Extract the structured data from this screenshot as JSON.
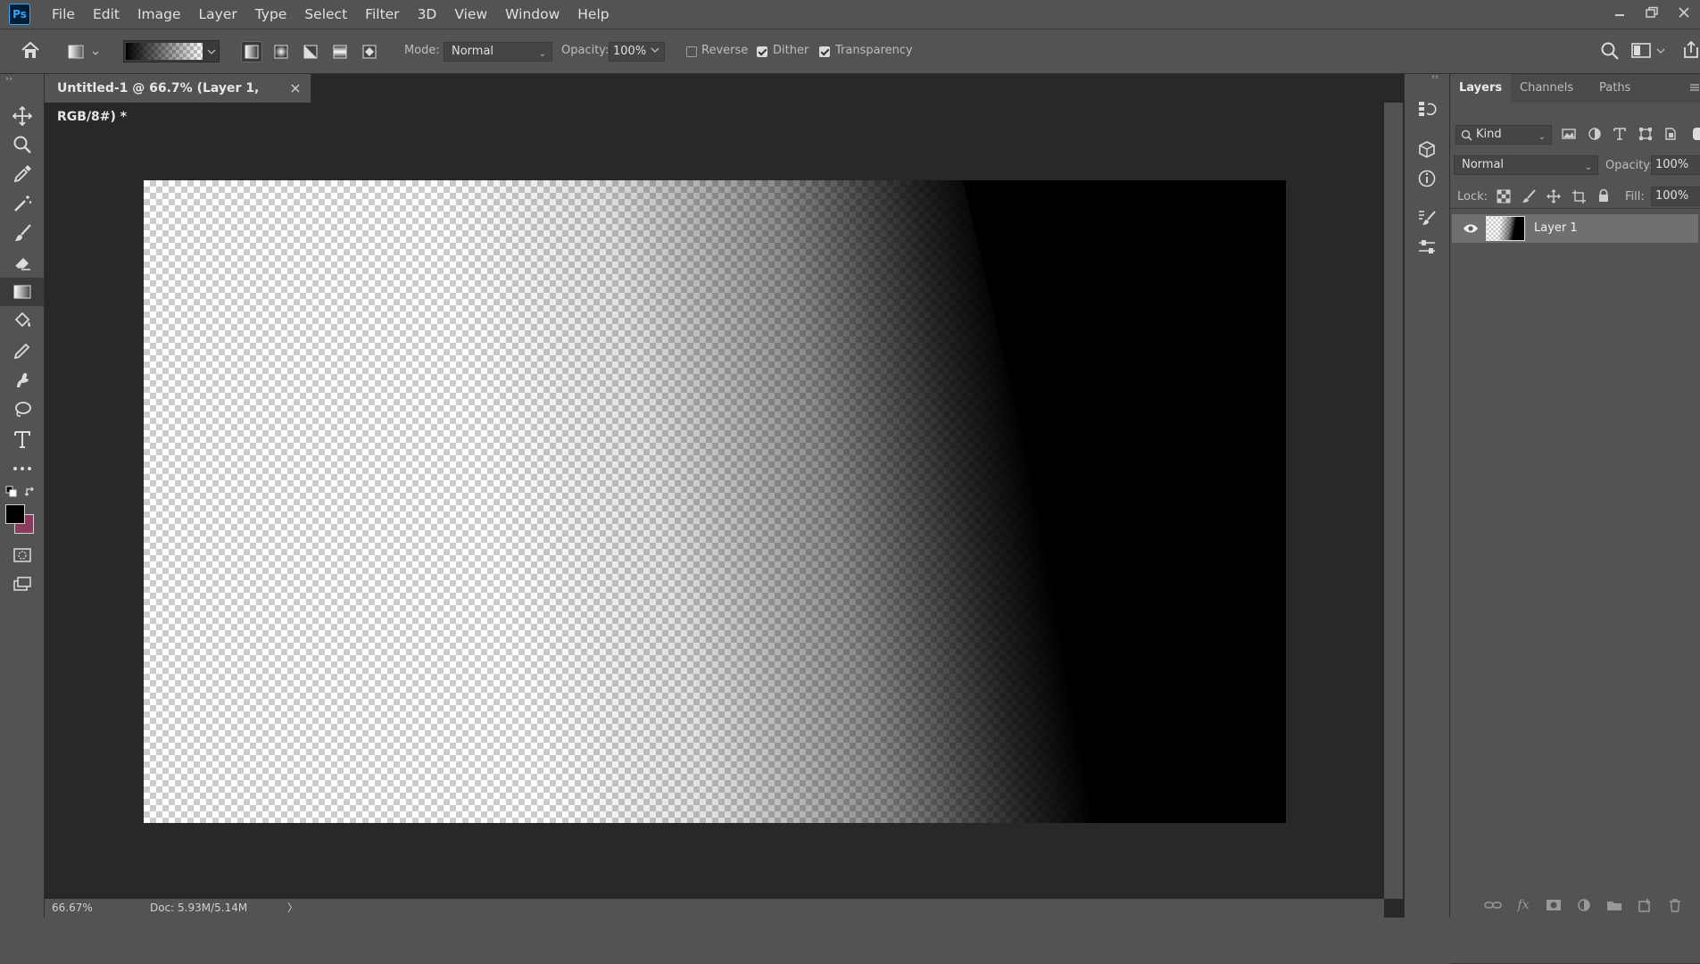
{
  "app": {
    "logo_text": "Ps",
    "menu": [
      "File",
      "Edit",
      "Image",
      "Layer",
      "Type",
      "Select",
      "Filter",
      "3D",
      "View",
      "Window",
      "Help"
    ]
  },
  "options": {
    "mode_label": "Mode:",
    "mode_value": "Normal",
    "opacity_label": "Opacity:",
    "opacity_value": "100%",
    "reverse_label": "Reverse",
    "reverse_checked": false,
    "dither_label": "Dither",
    "dither_checked": true,
    "transparency_label": "Transparency",
    "transparency_checked": true,
    "gradient_types": [
      "linear",
      "radial",
      "angle",
      "reflected",
      "diamond"
    ],
    "selected_gradient_type": "linear"
  },
  "document": {
    "tab_title": "Untitled-1 @ 66.7% (Layer 1, RGB/8#) *",
    "zoom": "66.67%",
    "doc_info": "Doc: 5.93M/5.14M",
    "status_arrow": "〉"
  },
  "colors": {
    "foreground": "#000000",
    "background": "#8a3c5e",
    "accent": "#31a8ff"
  },
  "layers_panel": {
    "tabs": [
      "Layers",
      "Channels",
      "Paths"
    ],
    "active_tab": "Layers",
    "filter_label": "Kind",
    "blend_mode": "Normal",
    "opacity_label": "Opacity:",
    "opacity_value": "100%",
    "lock_label": "Lock:",
    "fill_label": "Fill:",
    "fill_value": "100%",
    "layers": [
      {
        "name": "Layer 1",
        "visible": true,
        "selected": true
      }
    ]
  },
  "tools": [
    "move-tool",
    "zoom-tool",
    "eyedropper-tool",
    "magic-wand-tool",
    "brush-tool",
    "eraser-tool",
    "gradient-tool",
    "paint-bucket-tool",
    "pencil-tool",
    "smudge-tool",
    "lasso-tool",
    "type-tool",
    "more-tools"
  ]
}
